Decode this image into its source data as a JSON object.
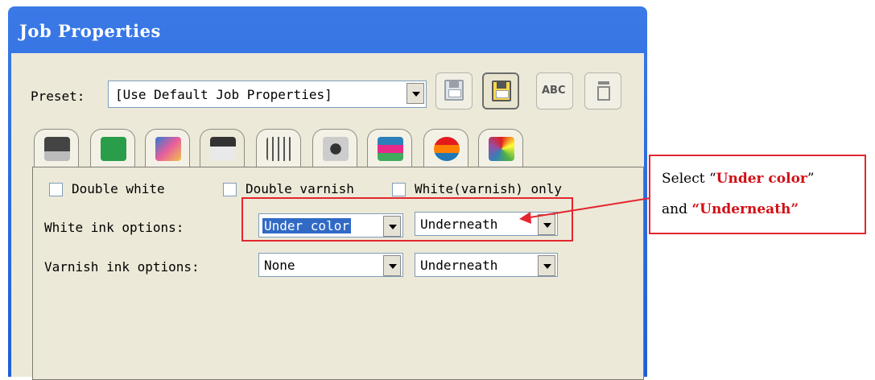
{
  "window": {
    "title": "Job Properties"
  },
  "preset": {
    "label": "Preset:",
    "value": "[Use Default Job Properties]"
  },
  "toolbar": {
    "buttons": [
      {
        "icon": "save-disabled-icon"
      },
      {
        "icon": "save-icon",
        "active": true
      },
      {
        "icon": "rename-abc-icon",
        "text": "ABC"
      },
      {
        "icon": "delete-icon"
      }
    ]
  },
  "tabs": [
    {
      "icon": "printer-media-icon"
    },
    {
      "icon": "layout-arrow-icon"
    },
    {
      "icon": "color-image-icon"
    },
    {
      "icon": "printer-active-icon",
      "active": true
    },
    {
      "icon": "grid-strip-icon"
    },
    {
      "icon": "target-adjust-icon"
    },
    {
      "icon": "color-bars-icon"
    },
    {
      "icon": "layers-icon"
    },
    {
      "icon": "color-picker-icon"
    }
  ],
  "options": {
    "double_white": "Double white",
    "double_varnish": "Double varnish",
    "white_only": "White(varnish) only",
    "white_ink_label": "White ink options:",
    "white_ink_value": "Under color",
    "white_ink_position": "Underneath",
    "varnish_ink_label": "Varnish ink options:",
    "varnish_ink_value": "None",
    "varnish_ink_position": "Underneath"
  },
  "annotation": {
    "line1_prefix": "Select  “",
    "line1_highlight": "Under color",
    "line1_suffix": "”",
    "line2_prefix": "and ",
    "line2_highlight": "“Underneath”",
    "color": "#e3262f"
  },
  "colors": {
    "title_bar": "#1f5fd6",
    "dialog_bg": "#ece9d8",
    "selection": "#316ac5"
  }
}
